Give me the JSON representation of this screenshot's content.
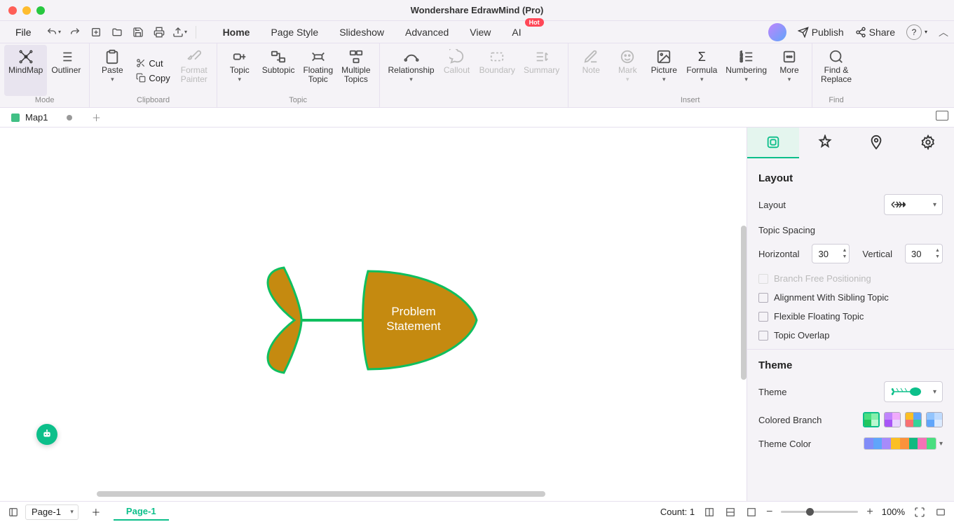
{
  "title": "Wondershare EdrawMind (Pro)",
  "menubar": {
    "file": "File"
  },
  "tabs": [
    "Home",
    "Page Style",
    "Slideshow",
    "Advanced",
    "View",
    "AI"
  ],
  "activeTab": "Home",
  "aiBadge": "Hot",
  "header": {
    "publish": "Publish",
    "share": "Share"
  },
  "ribbon": {
    "mode": {
      "label": "Mode",
      "mindmap": "MindMap",
      "outliner": "Outliner"
    },
    "clipboard": {
      "label": "Clipboard",
      "paste": "Paste",
      "cut": "Cut",
      "copy": "Copy",
      "format": "Format\nPainter"
    },
    "topic": {
      "label": "Topic",
      "topic": "Topic",
      "subtopic": "Subtopic",
      "floating": "Floating\nTopic",
      "multiple": "Multiple\nTopics"
    },
    "relations": {
      "relationship": "Relationship",
      "callout": "Callout",
      "boundary": "Boundary",
      "summary": "Summary"
    },
    "insert": {
      "label": "Insert",
      "note": "Note",
      "mark": "Mark",
      "picture": "Picture",
      "formula": "Formula",
      "numbering": "Numbering",
      "more": "More"
    },
    "find": {
      "label": "Find",
      "findreplace": "Find &\nReplace"
    }
  },
  "docTab": "Map1",
  "canvas": {
    "topic_line1": "Problem",
    "topic_line2": "Statement"
  },
  "panel": {
    "layout_h": "Layout",
    "layout_row": "Layout",
    "topic_spacing": "Topic Spacing",
    "horizontal": "Horizontal",
    "horizontal_v": "30",
    "vertical": "Vertical",
    "vertical_v": "30",
    "branch_free": "Branch Free Positioning",
    "align_sibling": "Alignment With Sibling Topic",
    "flex_floating": "Flexible Floating Topic",
    "overlap": "Topic Overlap",
    "theme_h": "Theme",
    "theme_row": "Theme",
    "colored_branch": "Colored Branch",
    "theme_color": "Theme Color"
  },
  "status": {
    "page_sel": "Page-1",
    "page_tab": "Page-1",
    "count": "Count: 1",
    "zoom": "100%"
  },
  "colors": {
    "fish_fill": "#c58a10",
    "fish_stroke": "#0fbf5f",
    "accent": "#0cbf8a"
  }
}
